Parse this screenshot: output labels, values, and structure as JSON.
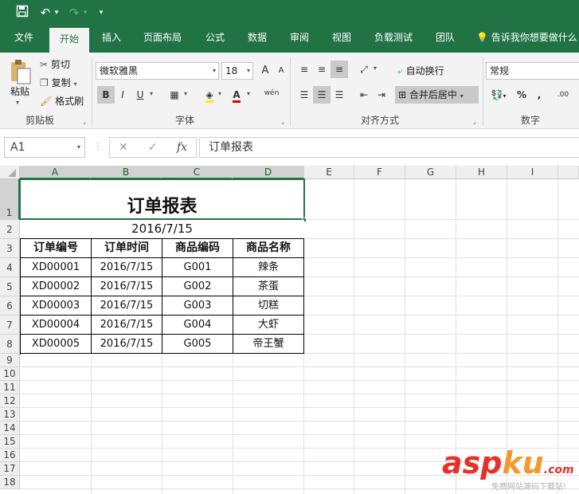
{
  "quick_access": {
    "save_icon": "save-icon",
    "undo_icon": "undo-icon",
    "undo_glyph": "↶",
    "dropdown_glyph": "▾",
    "redo_icon": "redo-icon",
    "redo_glyph": "↷",
    "customize_glyph": "▾"
  },
  "tabs": [
    "文件",
    "开始",
    "插入",
    "页面布局",
    "公式",
    "数据",
    "审阅",
    "视图",
    "负载测试",
    "团队"
  ],
  "active_tab": "开始",
  "tell_me": "告诉我你想要做什么",
  "ribbon": {
    "clipboard": {
      "paste": "粘贴",
      "cut": "剪切",
      "copy": "复制",
      "format_painter": "格式刷",
      "label": "剪贴板"
    },
    "font": {
      "name": "微软雅黑",
      "size": "18",
      "grow": "A",
      "shrink": "A",
      "bold": "B",
      "italic": "I",
      "underline": "U",
      "font_color_glyph": "A",
      "phonetic": "wén",
      "label": "字体"
    },
    "alignment": {
      "wrap_text": "自动换行",
      "merge_center": "合并后居中",
      "label": "对齐方式"
    },
    "number": {
      "format": "常规",
      "percent": "%",
      "comma": ",",
      "label": "数字"
    }
  },
  "formula_bar": {
    "name_box": "A1",
    "cancel": "✕",
    "enter": "✓",
    "fx": "fx",
    "content": "订单报表"
  },
  "columns": [
    "A",
    "B",
    "C",
    "D",
    "E",
    "F",
    "G",
    "H",
    "I"
  ],
  "rows": [
    "1",
    "2",
    "3",
    "4",
    "5",
    "6",
    "7",
    "8",
    "9",
    "10",
    "11",
    "12",
    "13",
    "14",
    "15",
    "16",
    "17",
    "18"
  ],
  "sheet": {
    "title": "订单报表",
    "date": "2016/7/15",
    "headers": [
      "订单编号",
      "订单时间",
      "商品编码",
      "商品名称"
    ],
    "records": [
      [
        "XD00001",
        "2016/7/15",
        "G001",
        "辣条"
      ],
      [
        "XD00002",
        "2016/7/15",
        "G002",
        "茶蛋"
      ],
      [
        "XD00003",
        "2016/7/15",
        "G003",
        "切糕"
      ],
      [
        "XD00004",
        "2016/7/15",
        "G004",
        "大虾"
      ],
      [
        "XD00005",
        "2016/7/15",
        "G005",
        "帝王蟹"
      ]
    ]
  },
  "watermark": {
    "logo_a": "asp",
    "logo_b": "ku",
    "logo_c": ".com",
    "tagline": "免费网站源码下载站!"
  }
}
